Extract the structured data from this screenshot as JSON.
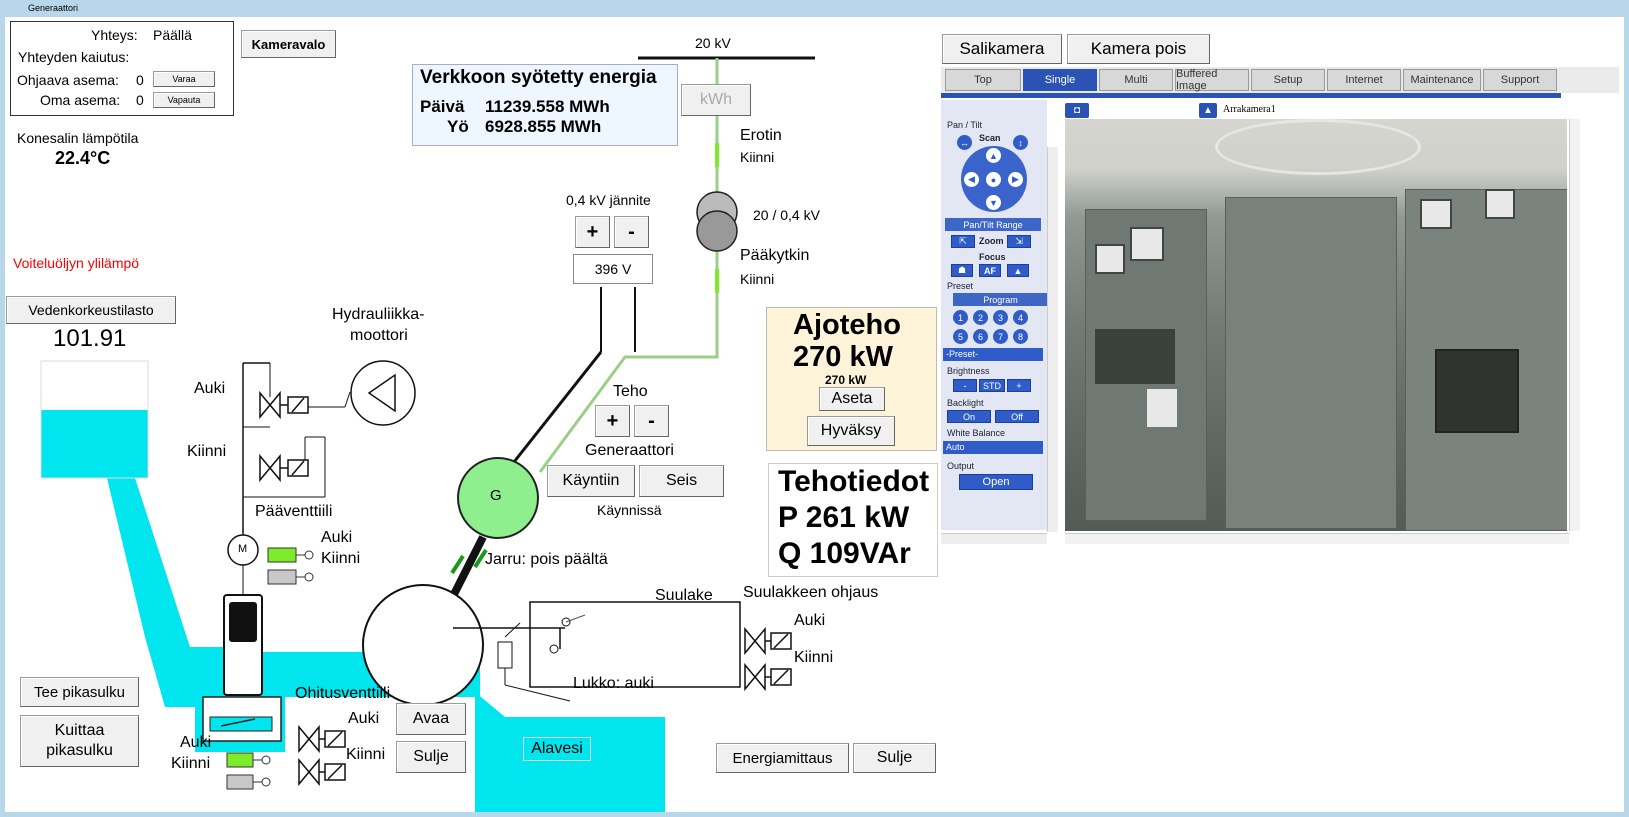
{
  "window": {
    "title": "Generaattori"
  },
  "connection": {
    "yhteys_label": "Yhteys:",
    "yhteys_value": "Päällä",
    "kaiutus_label": "Yhteyden kaiutus:",
    "ohjaava_label": "Ohjaava asema:",
    "ohjaava_value": "0",
    "varaa_button": "Varaa",
    "oma_label": "Oma asema:",
    "oma_value": "0",
    "vapauta_button": "Vapauta"
  },
  "kameravalo_button": "Kameravalo",
  "temperature": {
    "label": "Konesalin lämpötila",
    "value": "22.4°C"
  },
  "alarm": {
    "text": "Voiteluöljyn ylilämpö",
    "color": "#ff0000"
  },
  "water_level": {
    "button": "Vedenkorkeustilasto",
    "value": "101.91"
  },
  "energy": {
    "title": "Verkkoon syötetty energia",
    "paiva_label": "Päivä",
    "paiva_value": "11239.558 MWh",
    "yo_label": "Yö",
    "yo_value": "6928.855 MWh",
    "kwh_button": "kWh"
  },
  "grid": {
    "voltage_20kv": "20 kV",
    "erotin_label": "Erotin",
    "erotin_state": "Kiinni",
    "transformer_label": "20 / 0,4 kV",
    "paakytkin_label": "Pääkytkin",
    "paakytkin_state": "Kiinni",
    "voltage_04_label": "0,4 kV jännite",
    "plus": "+",
    "minus": "-",
    "voltage_value": "396 V"
  },
  "hydraulics": {
    "title_line1": "Hydrauliikka-",
    "title_line2": "moottori",
    "auki": "Auki",
    "kiinni": "Kiinni"
  },
  "main_valve": {
    "title": "Pääventtiili",
    "auki": "Auki",
    "kiinni": "Kiinni",
    "motor": "M"
  },
  "power_control": {
    "teho_label": "Teho",
    "plus": "+",
    "minus": "-"
  },
  "generator": {
    "label": "Generaattori",
    "symbol": "G",
    "kayntiin_button": "Käyntiin",
    "seis_button": "Seis",
    "status": "Käynnissä",
    "brake": "Jarru: pois päältä"
  },
  "run_power": {
    "title": "Ajoteho",
    "value": "270 kW",
    "setpoint": "270 kW",
    "aseta_button": "Aseta",
    "hyvaksy_button": "Hyväksy"
  },
  "power_info": {
    "title": "Tehotiedot",
    "p": "P 261 kW",
    "q": "Q 109VAr"
  },
  "nozzle": {
    "label": "Suulake",
    "control_label": "Suulakkeen ohjaus",
    "auki": "Auki",
    "kiinni": "Kiinni",
    "lock": "Lukko: auki"
  },
  "bypass": {
    "title": "Ohitusventtiili",
    "auki": "Auki",
    "kiinni": "Kiinni",
    "avaa_button": "Avaa",
    "sulje_button": "Sulje"
  },
  "quick_stop": {
    "tee_button": "Tee pikasulku",
    "kuittaa_line1": "Kuittaa",
    "kuittaa_line2": "pikasulku",
    "auki": "Auki",
    "kiinni": "Kiinni"
  },
  "alavesi": "Alavesi",
  "bottom_buttons": {
    "energiamittaus": "Energiamittaus",
    "sulje": "Sulje"
  },
  "camera_buttons": {
    "salikamera": "Salikamera",
    "kamera_pois": "Kamera pois"
  },
  "camera": {
    "tabs": [
      "Top",
      "Single",
      "Multi",
      "Buffered Image",
      "Setup",
      "Internet",
      "Maintenance",
      "Support"
    ],
    "active_tab": "Single",
    "camera_name": "Arrakamera1",
    "pan_tilt_label": "Pan / Tilt",
    "scan_label": "Scan",
    "pan_tilt_range": "Pan/Tilt Range",
    "zoom_label": "Zoom",
    "focus_label": "Focus",
    "af_label": "AF",
    "preset_label": "Preset",
    "program_label": "Program",
    "preset_numbers": [
      "1",
      "2",
      "3",
      "4",
      "5",
      "6",
      "7",
      "8"
    ],
    "preset_select": "-Preset-",
    "brightness_label": "Brightness",
    "brightness_buttons": [
      "-",
      "STD",
      "+"
    ],
    "backlight_label": "Backlight",
    "backlight_on": "On",
    "backlight_off": "Off",
    "white_balance_label": "White Balance",
    "white_balance_value": "Auto",
    "output_label": "Output",
    "output_open": "Open"
  },
  "colors": {
    "water": "#00e5ee",
    "green_indicator": "#7cec2a",
    "generator": "#8fef8f",
    "panel_bg": "#fdf3d8",
    "grid_line": "#9bcf85"
  }
}
